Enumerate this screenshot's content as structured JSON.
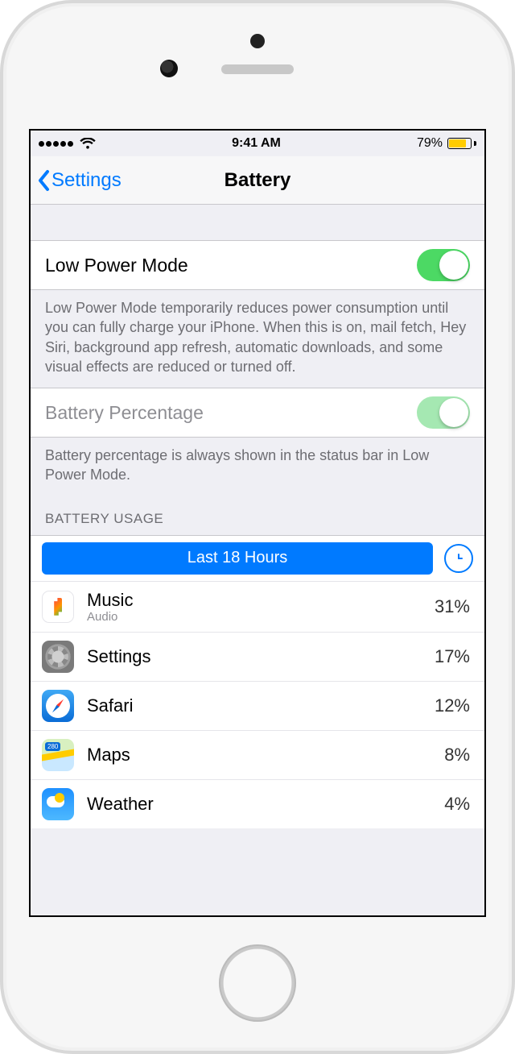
{
  "status": {
    "time": "9:41 AM",
    "battery_pct": "79%"
  },
  "nav": {
    "back": "Settings",
    "title": "Battery"
  },
  "low_power": {
    "label": "Low Power Mode",
    "on": true,
    "footer": "Low Power Mode temporarily reduces power consumption until you can fully charge your iPhone. When this is on, mail fetch, Hey Siri, background app refresh, automatic downloads, and some visual effects are reduced or turned off."
  },
  "battery_pct_row": {
    "label": "Battery Percentage",
    "on": true,
    "disabled": true,
    "footer": "Battery percentage is always shown in the status bar in Low Power Mode."
  },
  "usage": {
    "header": "BATTERY USAGE",
    "segment": "Last 18 Hours",
    "apps": [
      {
        "name": "Music",
        "sub": "Audio",
        "pct": "31%",
        "icon": "music"
      },
      {
        "name": "Settings",
        "sub": "",
        "pct": "17%",
        "icon": "settings"
      },
      {
        "name": "Safari",
        "sub": "",
        "pct": "12%",
        "icon": "safari"
      },
      {
        "name": "Maps",
        "sub": "",
        "pct": "8%",
        "icon": "maps"
      },
      {
        "name": "Weather",
        "sub": "",
        "pct": "4%",
        "icon": "weather"
      }
    ]
  }
}
